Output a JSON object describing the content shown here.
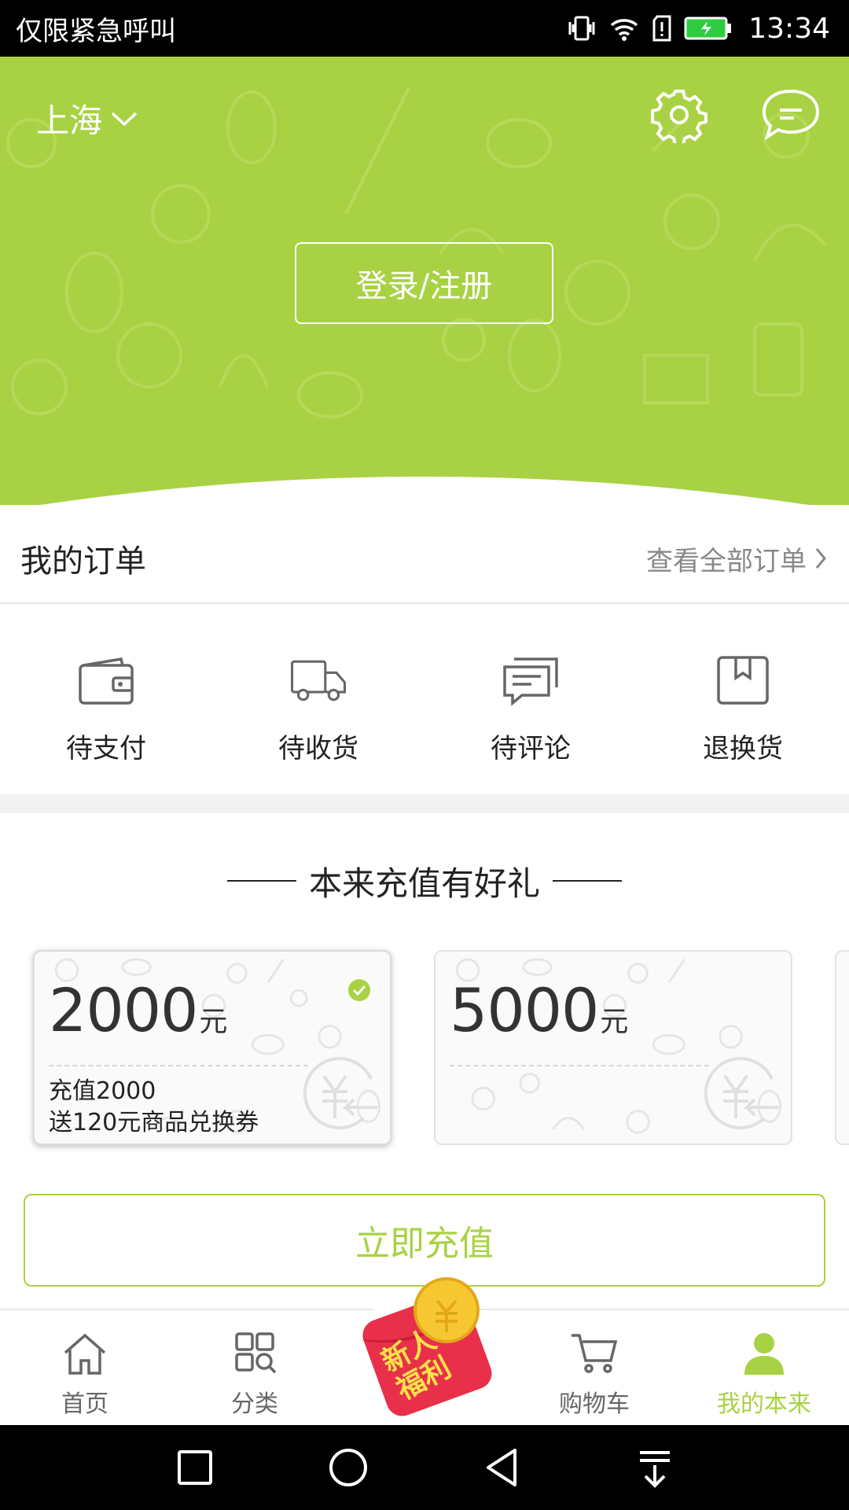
{
  "status_bar": {
    "carrier_text": "仅限紧急呼叫",
    "time": "13:34",
    "icons": [
      "vibrate-icon",
      "wifi-icon",
      "sim-alert-icon",
      "battery-charging-icon"
    ]
  },
  "header": {
    "city": "上海",
    "login_label": "登录/注册",
    "icons": [
      "chevron-down-icon",
      "gear-icon",
      "message-icon"
    ],
    "bg_color": "#a8d243"
  },
  "orders": {
    "title": "我的订单",
    "view_all": "查看全部订单",
    "items": [
      {
        "label": "待支付",
        "icon": "wallet-icon"
      },
      {
        "label": "待收货",
        "icon": "truck-icon"
      },
      {
        "label": "待评论",
        "icon": "comment-icon"
      },
      {
        "label": "退换货",
        "icon": "box-icon"
      }
    ]
  },
  "recharge": {
    "title": "本来充值有好礼",
    "cards": [
      {
        "amount": "2000",
        "unit": "元",
        "desc_line1": "充值2000",
        "desc_line2": "送120元商品兑换券",
        "selected": true
      },
      {
        "amount": "5000",
        "unit": "元",
        "desc_line1": "",
        "desc_line2": "",
        "selected": false
      }
    ],
    "button_label": "立即充值",
    "accent": "#a8d243"
  },
  "bottom_nav": {
    "items": [
      {
        "label": "首页",
        "icon": "home-icon"
      },
      {
        "label": "分类",
        "icon": "category-icon"
      },
      {
        "label": "购物车",
        "icon": "cart-icon"
      },
      {
        "label": "我的本来",
        "icon": "user-icon",
        "active": true
      }
    ],
    "newcomer_line1": "新人",
    "newcomer_line2": "福利"
  },
  "system_nav": {
    "icons": [
      "recents-icon",
      "home-circle-icon",
      "back-icon",
      "notification-pull-icon"
    ]
  }
}
